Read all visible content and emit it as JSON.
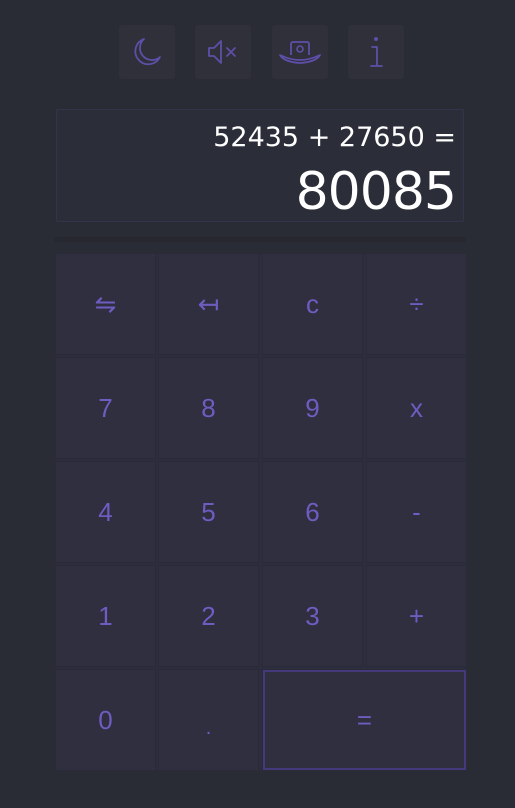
{
  "toolbar": {
    "theme_icon": "moon-icon",
    "sound_icon": "speaker-muted-icon",
    "hat_icon": "hat-icon",
    "info_icon": "info-icon"
  },
  "display": {
    "expression": "52435 + 27650 =",
    "result": "80085"
  },
  "keys": {
    "swap": "⇋",
    "backspace": "↤",
    "clear": "c",
    "divide": "÷",
    "seven": "7",
    "eight": "8",
    "nine": "9",
    "multiply": "x",
    "four": "4",
    "five": "5",
    "six": "6",
    "minus": "-",
    "one": "1",
    "two": "2",
    "three": "3",
    "plus": "+",
    "zero": "0",
    "decimal": ".",
    "equals": "="
  },
  "colors": {
    "background": "#2a2c35",
    "accent": "#6e5cc0",
    "key": "#2f2f40",
    "display_text": "#ffffff"
  }
}
